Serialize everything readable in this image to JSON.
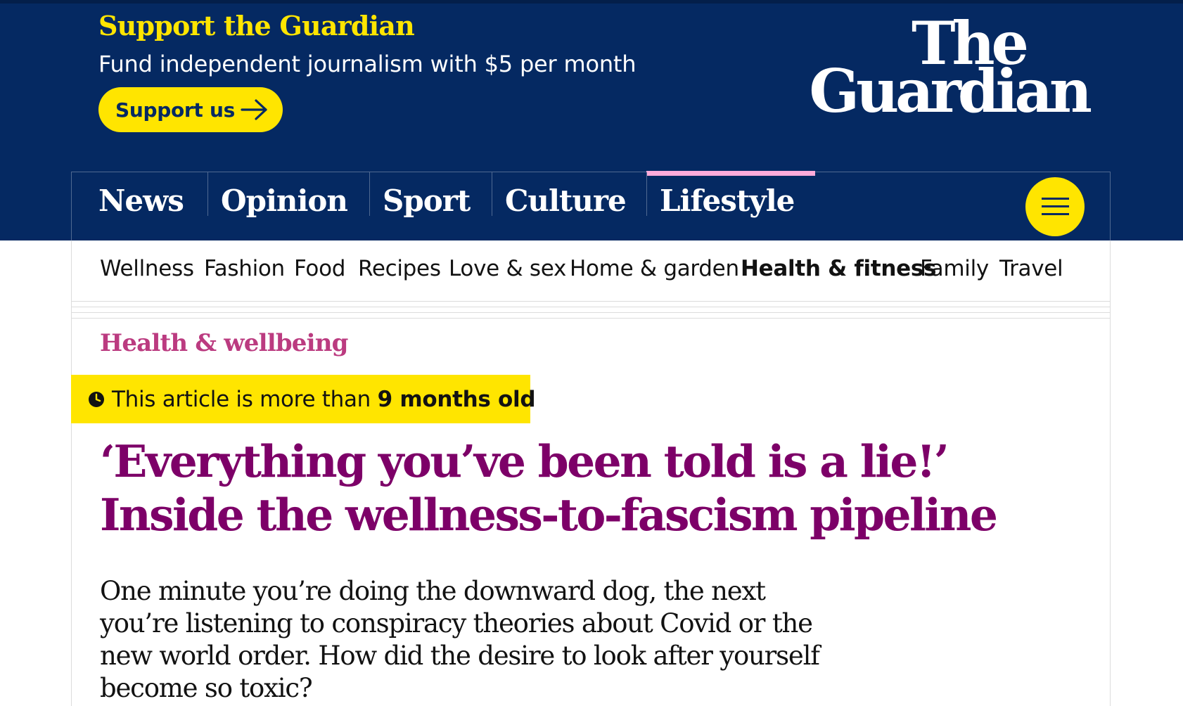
{
  "banner": {
    "heading": "Support the Guardian",
    "subheading": "Fund independent journalism with $5 per month",
    "button_label": "Support us",
    "button_icon": "arrow-right-icon"
  },
  "logo": {
    "line1": "The",
    "line2": "Guardian"
  },
  "pillars": [
    {
      "label": "News"
    },
    {
      "label": "Opinion"
    },
    {
      "label": "Sport"
    },
    {
      "label": "Culture"
    },
    {
      "label": "Lifestyle",
      "active": true
    }
  ],
  "menu_button": {
    "icon": "hamburger-menu-icon"
  },
  "subnav": [
    {
      "label": "Wellness"
    },
    {
      "label": "Fashion"
    },
    {
      "label": "Food"
    },
    {
      "label": "Recipes"
    },
    {
      "label": "Love & sex"
    },
    {
      "label": "Home & garden"
    },
    {
      "label": "Health & fitness",
      "current": true
    },
    {
      "label": "Family"
    },
    {
      "label": "Travel"
    }
  ],
  "article": {
    "section": "Health & wellbeing",
    "age_warning": {
      "icon": "clock-icon",
      "prefix": "This article is more than ",
      "age": "9 months old"
    },
    "headline": "‘Everything you’ve been told is a lie!’ Inside the wellness-to-fascism pipeline",
    "standfirst": "One minute you’re doing the downward dog, the next you’re listening to conspiracy theories about Covid or the new world order. How did the desire to look after yourself become so toxic?"
  },
  "colors": {
    "brand_blue": "#052962",
    "support_yellow": "#ffe500",
    "lifestyle_pink": "#ffabdb",
    "section_pink": "#bb3b80",
    "headline_purple": "#7d0068"
  }
}
